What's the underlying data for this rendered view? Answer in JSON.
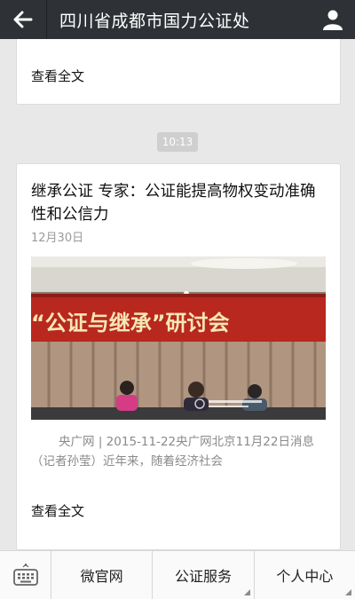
{
  "header": {
    "back_icon": "arrow-left-icon",
    "title": "四川省成都市国力公证处",
    "user_icon": "person-icon"
  },
  "previous_card": {
    "read_more": "查看全文"
  },
  "time_badge": "10:13",
  "article": {
    "title": "继承公证 专家：公证能提高物权变动准确性和公信力",
    "date": "12月30日",
    "image_banner_text": "“公证与继承”研讨会",
    "excerpt": "央广网 | 2015-11-22央广网北京11月22日消息（记者孙莹）近年来，随着经济社会",
    "read_more": "查看全文"
  },
  "bottom_menu": {
    "keyboard_icon": "keyboard-icon",
    "items": [
      {
        "label": "微官网"
      },
      {
        "label": "公证服务"
      },
      {
        "label": "个人中心"
      }
    ]
  }
}
